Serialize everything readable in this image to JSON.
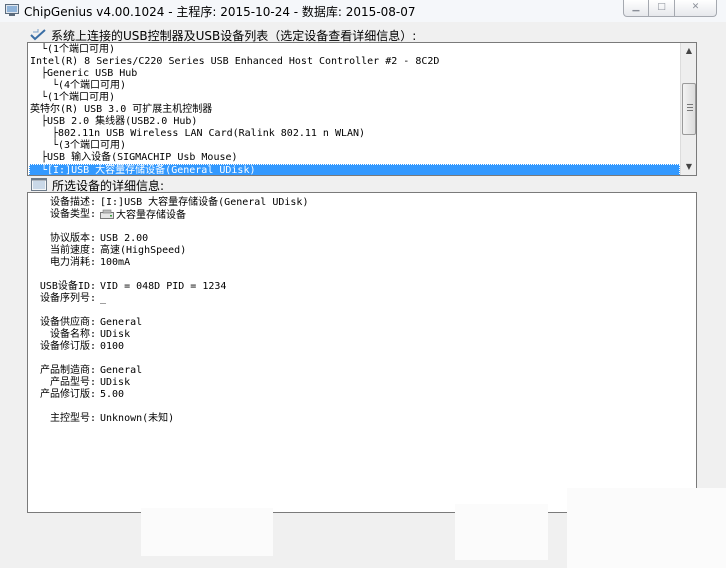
{
  "window": {
    "title": "ChipGenius v4.00.1024 - 主程序: 2015-10-24 - 数据库: 2015-08-07",
    "minimize_glyph": "▁",
    "maximize_glyph": "□",
    "close_glyph": "✕"
  },
  "device_list": {
    "label": "系统上连接的USB控制器及USB设备列表（选定设备查看详细信息）:",
    "items": [
      {
        "text": "└(1个端口可用)",
        "indent": 1,
        "selected": false
      },
      {
        "text": "Intel(R) 8 Series/C220 Series USB Enhanced Host Controller #2 - 8C2D",
        "indent": 0,
        "selected": false
      },
      {
        "text": "├Generic USB Hub",
        "indent": 1,
        "selected": false
      },
      {
        "text": "└(4个端口可用)",
        "indent": 2,
        "selected": false
      },
      {
        "text": "└(1个端口可用)",
        "indent": 1,
        "selected": false
      },
      {
        "text": "英特尔(R) USB 3.0 可扩展主机控制器",
        "indent": 0,
        "selected": false
      },
      {
        "text": "├USB 2.0 集线器(USB2.0 Hub)",
        "indent": 1,
        "selected": false
      },
      {
        "text": "├802.11n USB Wireless LAN Card(Ralink 802.11 n WLAN)",
        "indent": 2,
        "selected": false
      },
      {
        "text": "└(3个端口可用)",
        "indent": 2,
        "selected": false
      },
      {
        "text": "├USB 输入设备(SIGMACHIP Usb Mouse)",
        "indent": 1,
        "selected": false
      },
      {
        "text": "└[I:]USB 大容量存储设备(General UDisk)",
        "indent": 1,
        "selected": true
      }
    ]
  },
  "details": {
    "label": "所选设备的详细信息:",
    "rows": [
      {
        "label": "设备描述:",
        "value": "[I:]USB 大容量存储设备(General UDisk)",
        "icon": ""
      },
      {
        "label": "设备类型:",
        "value": "大容量存储设备",
        "icon": "usb-disk-icon"
      },
      {
        "label": "",
        "value": "",
        "icon": ""
      },
      {
        "label": "协议版本:",
        "value": "USB 2.00",
        "icon": ""
      },
      {
        "label": "当前速度:",
        "value": "高速(HighSpeed)",
        "icon": ""
      },
      {
        "label": "电力消耗:",
        "value": "100mA",
        "icon": ""
      },
      {
        "label": "",
        "value": "",
        "icon": ""
      },
      {
        "label": "USB设备ID:",
        "value": "VID = 048D PID = 1234",
        "icon": ""
      },
      {
        "label": "设备序列号:",
        "value": "_",
        "icon": ""
      },
      {
        "label": "",
        "value": "",
        "icon": ""
      },
      {
        "label": "设备供应商:",
        "value": "General",
        "icon": ""
      },
      {
        "label": "设备名称:",
        "value": "UDisk",
        "icon": ""
      },
      {
        "label": "设备修订版:",
        "value": "0100",
        "icon": ""
      },
      {
        "label": "",
        "value": "",
        "icon": ""
      },
      {
        "label": "产品制造商:",
        "value": "General",
        "icon": ""
      },
      {
        "label": "产品型号:",
        "value": "UDisk",
        "icon": ""
      },
      {
        "label": "产品修订版:",
        "value": "5.00",
        "icon": ""
      },
      {
        "label": "",
        "value": "",
        "icon": ""
      },
      {
        "label": "主控型号:",
        "value": "Unknown(未知)",
        "icon": ""
      }
    ]
  },
  "colors": {
    "selection": "#3399ff",
    "selection_text": "#ffffff",
    "border": "#7a7a7a"
  }
}
